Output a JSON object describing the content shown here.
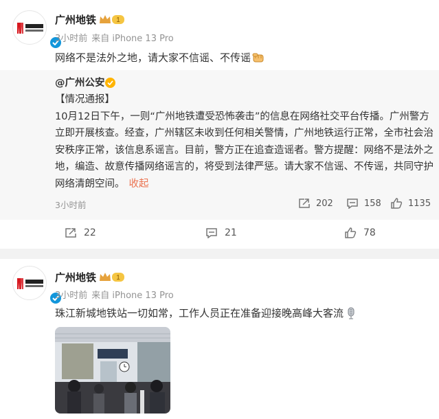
{
  "posts": [
    {
      "username": "广州地铁",
      "level_badge": "1",
      "time": "3小时前",
      "source": "来自 iPhone 13 Pro",
      "content": "网络不是法外之地，请大家不信谣、不传谣",
      "content_emoji": "fist-emoji",
      "repost": {
        "username": "@广州公安",
        "lines": [
          "【情况通报】",
          "10月12日下午，一则“广州地铁遭受恐怖袭击”的信息在网络社交平台传播。广州警方",
          "立即开展核查。经查，广州辖区未收到任何相关警情，广州地铁运行正常，全市社会治",
          "安秩序正常，该信息系谣言。目前，警方正在追查造谣者。警方提醒：网络不是法外之",
          "地，编造、故意传播网络谣言的，将受到法律严惩。请大家不信谣、不传谣，共同守护"
        ],
        "last_line": "网络清朗空间。",
        "collapse_label": "收起",
        "time": "3小时前",
        "repost_count": "202",
        "comment_count": "158",
        "like_count": "1135"
      },
      "actions": {
        "repost_count": "22",
        "comment_count": "21",
        "like_count": "78"
      }
    },
    {
      "username": "广州地铁",
      "level_badge": "1",
      "time": "3小时前",
      "source": "来自 iPhone 13 Pro",
      "content": "珠江新城地铁站一切如常，工作人员正在准备迎接晚高峰大客流",
      "content_emoji": "microphone-emoji"
    }
  ],
  "colors": {
    "accent": "#eb7350",
    "verified_blue": "#1296db",
    "verified_gold": "#ffb400",
    "gray": "#939393"
  }
}
